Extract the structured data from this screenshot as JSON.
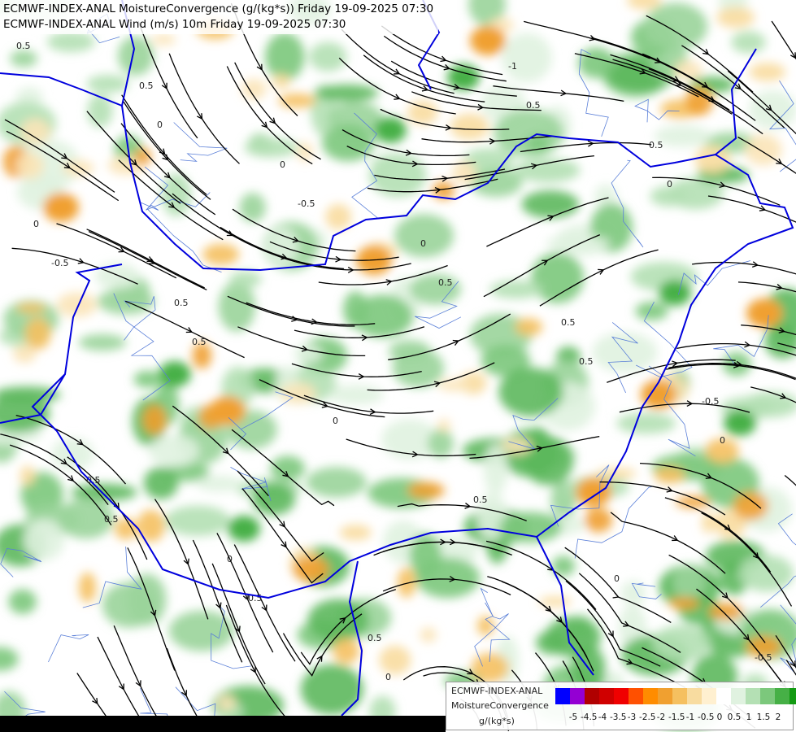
{
  "titles": {
    "line1": "ECMWF-INDEX-ANAL MoistureConvergence (g/(kg*s)) Friday 19-09-2025 07:30",
    "line2": "ECMWF-INDEX-ANAL Wind (m/s) 10m Friday 19-09-2025 07:30"
  },
  "legend": {
    "line1": "ECMWF-INDEX-ANAL",
    "line2": "MoistureConvergence",
    "unit": "g/(kg*s)",
    "colors": [
      "#0000ff",
      "#9400d3",
      "#b00000",
      "#d00000",
      "#f00000",
      "#ff5000",
      "#ff8c00",
      "#f0a030",
      "#f5c060",
      "#f8dca0",
      "#fff0d0",
      "#ffffff",
      "#e0f2e0",
      "#b4e0b4",
      "#7cc87c",
      "#46b046",
      "#129a12"
    ],
    "ticks": [
      "-5",
      "-4.5",
      "-4",
      "-3.5",
      "-3",
      "-2.5",
      "-2",
      "-1.5",
      "-1",
      "-0.5",
      "0",
      "0.5",
      "1",
      "1.5",
      "2"
    ]
  },
  "contour_labels": [
    "0.5",
    "0",
    "-0.5",
    "0.5",
    "0.5",
    "0",
    "0.5",
    "-0.5",
    "0",
    "0.5",
    "0",
    "-0.5",
    "0.5",
    "0",
    "0.5",
    "0",
    "-0.5",
    "0.5",
    "0",
    "0",
    "0.5",
    "-0.5",
    "0.5",
    "0",
    "0.5",
    "-1",
    "0.5",
    "0",
    "0.5"
  ],
  "colors": {
    "border": "#0000dd",
    "streamline": "#000000",
    "river": "#5a7fd8"
  }
}
